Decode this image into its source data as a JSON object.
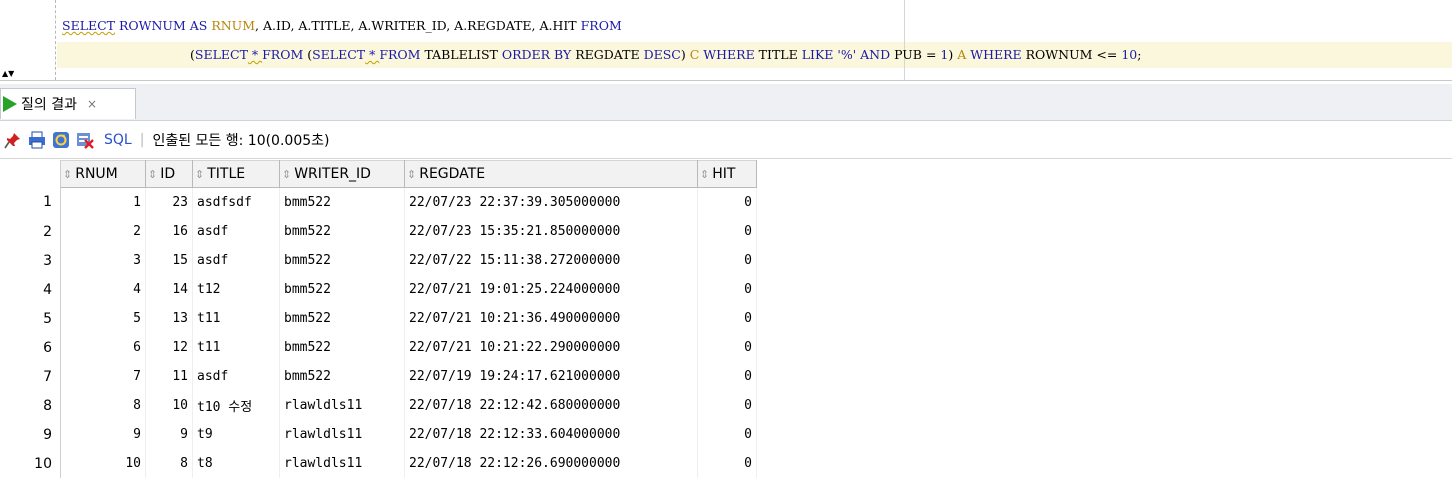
{
  "editor": {
    "line1": [
      {
        "t": "SELECT",
        "c": "kwu"
      },
      {
        "t": " ROWNUM ",
        "c": "kw"
      },
      {
        "t": "AS",
        "c": "kw"
      },
      {
        "t": " RNUM",
        "c": "alias"
      },
      {
        "t": ", A.ID, A.TITLE, A.WRITER_ID, A.REGDATE, A.HIT ",
        "c": "plain"
      },
      {
        "t": "FROM",
        "c": "kw"
      }
    ],
    "line2": [
      {
        "t": "(",
        "c": "plain"
      },
      {
        "t": "SELECT",
        "c": "kw"
      },
      {
        "t": " * ",
        "c": "kwu"
      },
      {
        "t": "FROM",
        "c": "kw"
      },
      {
        "t": " (",
        "c": "plain"
      },
      {
        "t": "SELECT",
        "c": "kw"
      },
      {
        "t": " * ",
        "c": "kwu"
      },
      {
        "t": "FROM",
        "c": "kw"
      },
      {
        "t": " TABLELIST ",
        "c": "plain"
      },
      {
        "t": "ORDER BY",
        "c": "kw"
      },
      {
        "t": " REGDATE ",
        "c": "plain"
      },
      {
        "t": "DESC",
        "c": "kw"
      },
      {
        "t": ") ",
        "c": "plain"
      },
      {
        "t": "C",
        "c": "alias"
      },
      {
        "t": " ",
        "c": "plain"
      },
      {
        "t": "WHERE",
        "c": "kw"
      },
      {
        "t": " TITLE ",
        "c": "plain"
      },
      {
        "t": "LIKE",
        "c": "kw"
      },
      {
        "t": " '%' ",
        "c": "str"
      },
      {
        "t": "AND",
        "c": "kw"
      },
      {
        "t": " PUB = ",
        "c": "plain"
      },
      {
        "t": "1",
        "c": "num"
      },
      {
        "t": ") ",
        "c": "plain"
      },
      {
        "t": "A",
        "c": "alias"
      },
      {
        "t": " ",
        "c": "plain"
      },
      {
        "t": "WHERE",
        "c": "kw"
      },
      {
        "t": " ROWNUM <= ",
        "c": "plain"
      },
      {
        "t": "10",
        "c": "num"
      },
      {
        "t": ";",
        "c": "plain"
      }
    ],
    "split_arrows": "▲▼"
  },
  "tab": {
    "label": "질의 결과",
    "close": "×"
  },
  "toolbar": {
    "sql_label": "SQL",
    "separator": "|",
    "status": "인출된 모든 행: 10(0.005초)"
  },
  "colors": {
    "keyword": "#1a1aa6",
    "alias": "#b8860b",
    "sql_link": "#2a4fcf",
    "play": "#27a327"
  },
  "grid": {
    "sort_glyph": "⇕",
    "columns": [
      "RNUM",
      "ID",
      "TITLE",
      "WRITER_ID",
      "REGDATE",
      "HIT"
    ],
    "rows": [
      {
        "n": "1",
        "rnum": "1",
        "id": "23",
        "title": "asdfsdf",
        "writer": "bmm522",
        "regdate": "22/07/23 22:37:39.305000000",
        "hit": "0"
      },
      {
        "n": "2",
        "rnum": "2",
        "id": "16",
        "title": "asdf",
        "writer": "bmm522",
        "regdate": "22/07/23 15:35:21.850000000",
        "hit": "0"
      },
      {
        "n": "3",
        "rnum": "3",
        "id": "15",
        "title": "asdf",
        "writer": "bmm522",
        "regdate": "22/07/22 15:11:38.272000000",
        "hit": "0"
      },
      {
        "n": "4",
        "rnum": "4",
        "id": "14",
        "title": "t12",
        "writer": "bmm522",
        "regdate": "22/07/21 19:01:25.224000000",
        "hit": "0"
      },
      {
        "n": "5",
        "rnum": "5",
        "id": "13",
        "title": "t11",
        "writer": "bmm522",
        "regdate": "22/07/21 10:21:36.490000000",
        "hit": "0"
      },
      {
        "n": "6",
        "rnum": "6",
        "id": "12",
        "title": "t11",
        "writer": "bmm522",
        "regdate": "22/07/21 10:21:22.290000000",
        "hit": "0"
      },
      {
        "n": "7",
        "rnum": "7",
        "id": "11",
        "title": "asdf",
        "writer": "bmm522",
        "regdate": "22/07/19 19:24:17.621000000",
        "hit": "0"
      },
      {
        "n": "8",
        "rnum": "8",
        "id": "10",
        "title": "t10 수정",
        "writer": "rlawldls11",
        "regdate": "22/07/18 22:12:42.680000000",
        "hit": "0"
      },
      {
        "n": "9",
        "rnum": "9",
        "id": "9",
        "title": "t9",
        "writer": "rlawldls11",
        "regdate": "22/07/18 22:12:33.604000000",
        "hit": "0"
      },
      {
        "n": "10",
        "rnum": "10",
        "id": "8",
        "title": "t8",
        "writer": "rlawldls11",
        "regdate": "22/07/18 22:12:26.690000000",
        "hit": "0"
      }
    ]
  }
}
